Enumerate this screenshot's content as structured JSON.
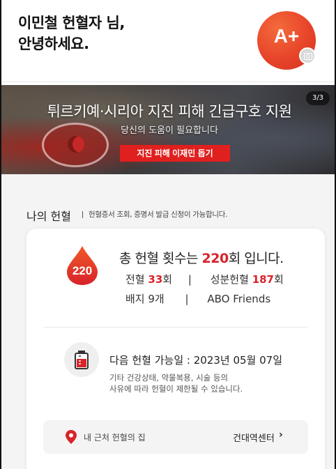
{
  "header": {
    "greeting_line1": "이민철 헌혈자 님,",
    "greeting_line2": "안녕하세요.",
    "grade": "A+"
  },
  "banner": {
    "title": "튀르키예·시리아 지진 피해 긴급구호 지원",
    "subtitle": "당신의 도움이 필요합니다",
    "button_label": "지진 피해 이재민 돕기",
    "page_indicator": "3/3"
  },
  "section": {
    "title": "나의 헌혈",
    "separator": "|",
    "description": "헌혈증서 조회, 증명서 발급 신청이 가능합니다."
  },
  "stats": {
    "drop_count": "220",
    "total_prefix": "총 헌혈 횟수는",
    "total_count": "220",
    "total_suffix": "회 입니다.",
    "whole_label": "전혈",
    "whole_count": "33",
    "whole_unit": "회",
    "sep": "|",
    "component_label": "성분헌혈",
    "component_count": "187",
    "component_unit": "회",
    "badge_label": "배지 9개",
    "badge_name": "ABO Friends"
  },
  "next": {
    "title": "다음 헌혈 가능일 : 2023년 05월 07일",
    "note_line1": "기타 건강상태, 약물복용, 시술 등의",
    "note_line2": "사유에 따라 헌혈이 제한될 수 있습니다."
  },
  "nearby": {
    "label": "내 근처 헌혈의 집",
    "value": "건대역센터",
    "chevron": "›"
  },
  "colors": {
    "accent": "#d8232a",
    "button": "#e0201f",
    "avatar": "#e8442a"
  }
}
